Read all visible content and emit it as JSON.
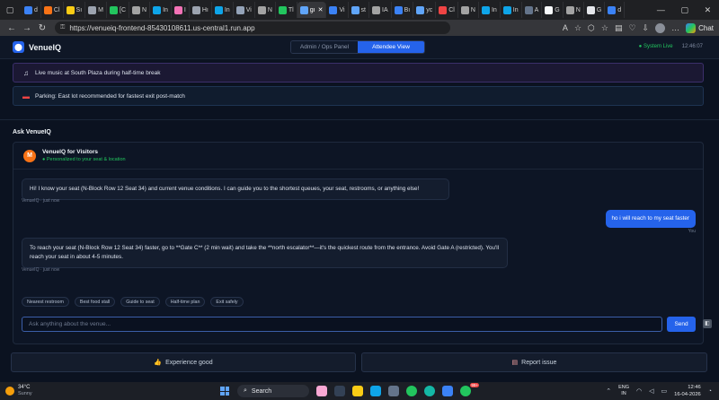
{
  "browser": {
    "tabs": [
      {
        "label": "d",
        "color": "#3b82f6"
      },
      {
        "label": "Cl",
        "color": "#f97316"
      },
      {
        "label": "Sı",
        "color": "#facc15"
      },
      {
        "label": "M",
        "color": "#9ca3af"
      },
      {
        "label": "[C",
        "color": "#22c55e"
      },
      {
        "label": "N",
        "color": "#a3a3a3"
      },
      {
        "label": "In",
        "color": "#0ea5e9"
      },
      {
        "label": "I",
        "color": "#f472b6"
      },
      {
        "label": "Hı",
        "color": "#9ca3af"
      },
      {
        "label": "In",
        "color": "#0ea5e9"
      },
      {
        "label": "Vi",
        "color": "#94a3b8"
      },
      {
        "label": "N",
        "color": "#a3a3a3"
      },
      {
        "label": "Tl",
        "color": "#22c55e"
      },
      {
        "label": "gı",
        "color": "#60a5fa"
      },
      {
        "label": "Vi",
        "color": "#3b82f6"
      },
      {
        "label": "st",
        "color": "#60a5fa"
      },
      {
        "label": "IA",
        "color": "#a3a3a3"
      },
      {
        "label": "Bı",
        "color": "#3b82f6"
      },
      {
        "label": "yc",
        "color": "#60a5fa"
      },
      {
        "label": "Cl",
        "color": "#ef4444"
      },
      {
        "label": "N",
        "color": "#a3a3a3"
      },
      {
        "label": "In",
        "color": "#0ea5e9"
      },
      {
        "label": "In",
        "color": "#0ea5e9"
      },
      {
        "label": "A",
        "color": "#64748b"
      },
      {
        "label": "G",
        "color": "#f8fafc"
      },
      {
        "label": "N",
        "color": "#a3a3a3"
      },
      {
        "label": "G",
        "color": "#e5e7eb"
      },
      {
        "label": "d",
        "color": "#3b82f6"
      }
    ],
    "active_tab_index": 13,
    "url": "https://venueiq-frontend-85430108611.us-central1.run.app",
    "chat_label": "Chat"
  },
  "header": {
    "brand": "VenueIQ",
    "views": [
      "Admin / Ops Panel",
      "Attendee View"
    ],
    "active_view_index": 1,
    "status": "System Live",
    "time": "12:46:07"
  },
  "notices": {
    "music": "Live music at South Plaza during half-time break",
    "parking": "Parking: East lot recommended for fastest exit post-match"
  },
  "ask": {
    "title": "Ask VenueIQ",
    "bot_name": "VenueIQ for Visitors",
    "bot_sub": "Personalized to your seat & location",
    "avatar_letter": "M",
    "messages": [
      {
        "from": "bot",
        "text": "Hi! I know your seat (N-Block Row 12 Seat 34) and current venue conditions. I can guide you to the shortest queues, your seat, restrooms, or anything else!",
        "meta": "VenueIQ · just now"
      },
      {
        "from": "user",
        "text": "ho i will reach to my seat faster",
        "meta": "You"
      },
      {
        "from": "bot",
        "text": "To reach your seat (N-Block Row 12 Seat 34) faster, go to **Gate C** (2 min wait) and take the **north escalator**—it's the quickest route from the entrance. Avoid Gate A (restricted). You'll reach your seat in about 4-5 minutes.",
        "meta": "VenueIQ · just now"
      }
    ],
    "chips": [
      "Nearest restroom",
      "Best food stall",
      "Guide to seat",
      "Half-time plan",
      "Exit safely"
    ],
    "placeholder": "Ask anything about the venue...",
    "send_label": "Send"
  },
  "feedback": {
    "good": "Experience good",
    "issue": "Report issue"
  },
  "taskbar": {
    "temp": "34°C",
    "condition": "Sunny",
    "search": "Search",
    "lang1": "ENG",
    "lang2": "IN",
    "time": "12:46",
    "date": "16-04-2026",
    "badge": "99+"
  }
}
